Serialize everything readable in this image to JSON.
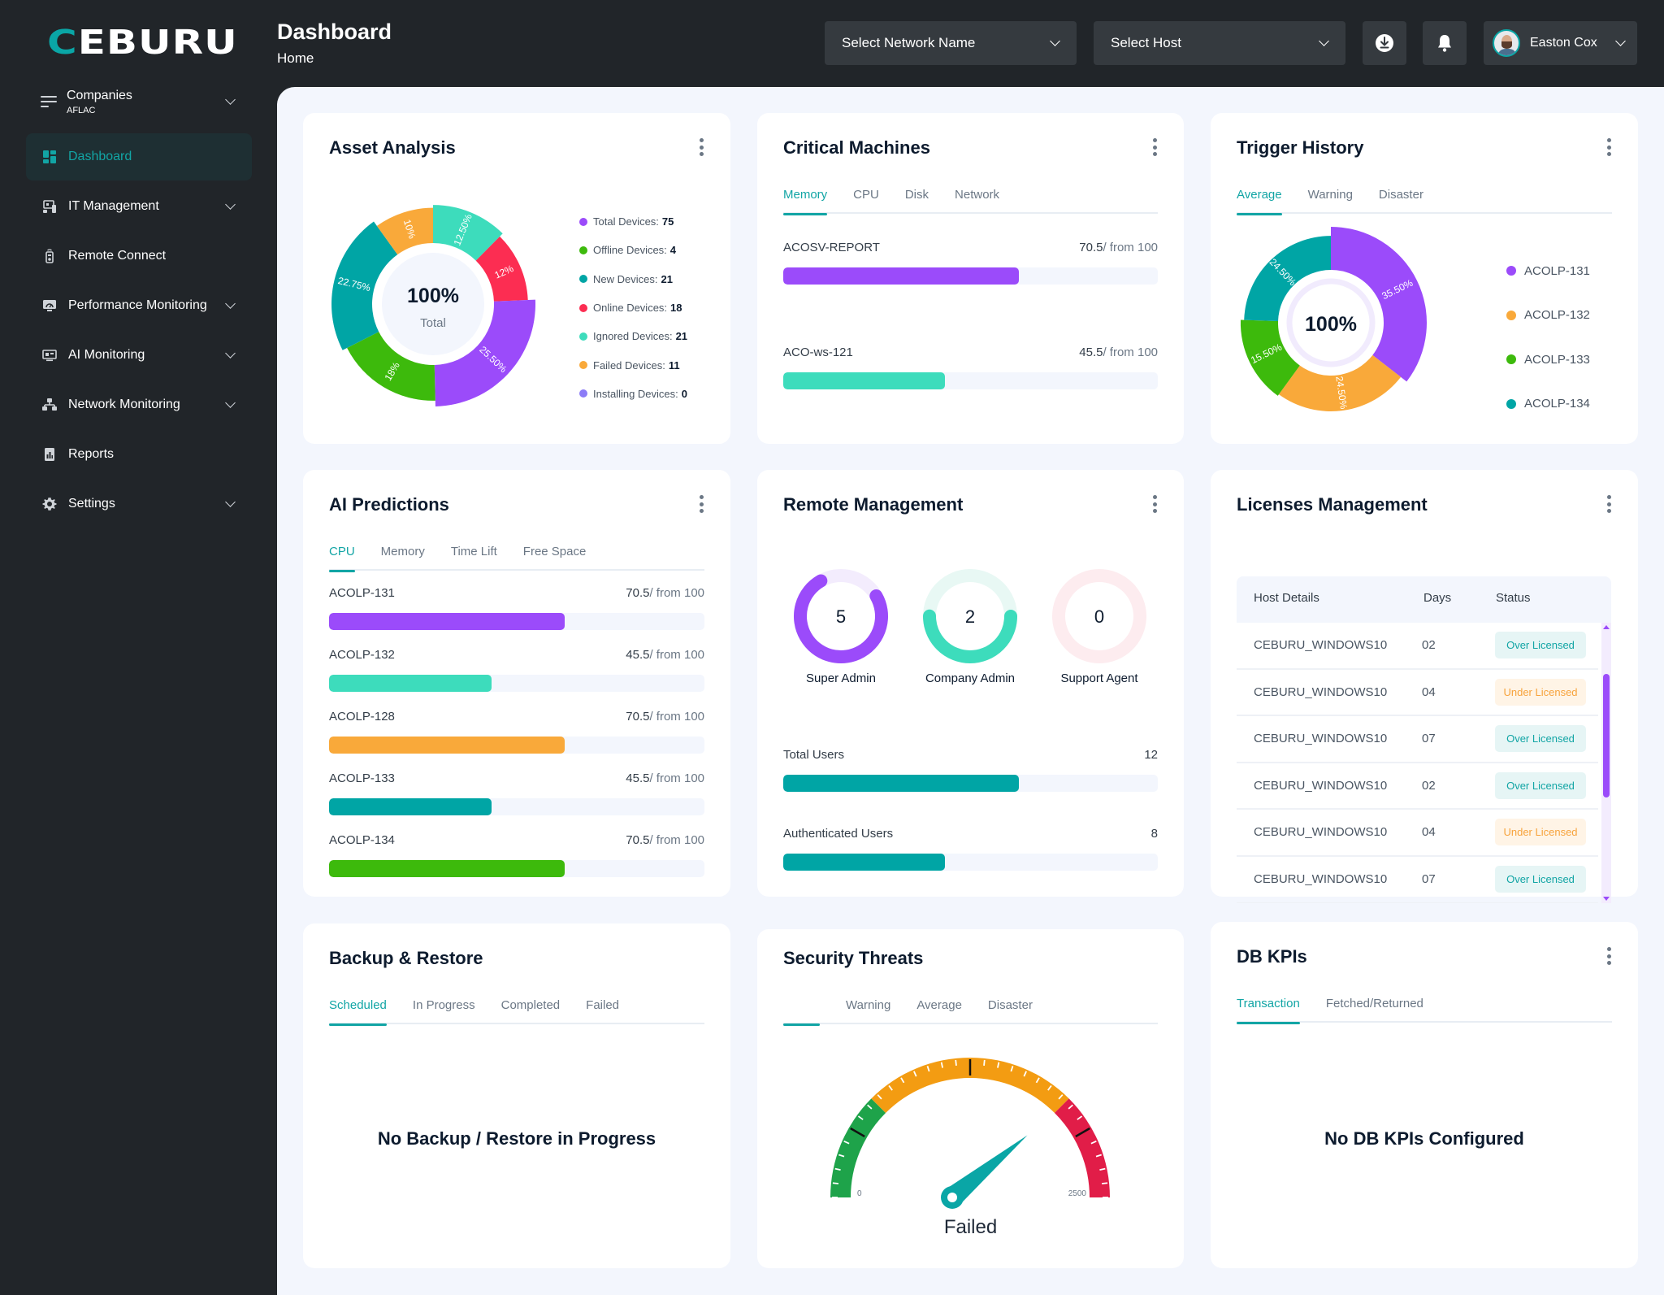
{
  "app": {
    "logo_first": "C",
    "logo_rest": "EBURU",
    "brand_color": "#12a5a5"
  },
  "sidebar": {
    "company": {
      "label": "Companies",
      "value": "AFLAC",
      "icon": "menu-lines-icon"
    },
    "items": [
      {
        "label": "Dashboard",
        "icon": "dashboard-icon",
        "active": true,
        "expandable": false
      },
      {
        "label": "IT Management",
        "icon": "it-management-icon",
        "expandable": true
      },
      {
        "label": "Remote Connect",
        "icon": "remote-icon",
        "expandable": false
      },
      {
        "label": "Performance Monitoring",
        "icon": "gauge-monitor-icon",
        "expandable": true
      },
      {
        "label": "AI Monitoring",
        "icon": "ai-monitor-icon",
        "expandable": true
      },
      {
        "label": "Network Monitoring",
        "icon": "network-icon",
        "expandable": true
      },
      {
        "label": "Reports",
        "icon": "report-icon",
        "expandable": false
      },
      {
        "label": "Settings",
        "icon": "gear-icon",
        "expandable": true
      }
    ]
  },
  "header": {
    "title": "Dashboard",
    "breadcrumb": "Home",
    "network_select": "Select Network Name",
    "host_select": "Select Host",
    "download_icon": "download-icon",
    "bell_icon": "bell-icon",
    "user_name": "Easton Cox"
  },
  "asset_analysis": {
    "title": "Asset Analysis",
    "center_value": "100%",
    "center_label": "Total",
    "legend": [
      {
        "label": "Total Devices:",
        "value": "75",
        "color": "#9b4bfa"
      },
      {
        "label": "Offline Devices:",
        "value": "4",
        "color": "#3dba0c"
      },
      {
        "label": "New Devices:",
        "value": "21",
        "color": "#00a5a5"
      },
      {
        "label": "Online Devices:",
        "value": "18",
        "color": "#fc2d52"
      },
      {
        "label": "Ignored Devices:",
        "value": "21",
        "color": "#3ddcbc"
      },
      {
        "label": "Failed Devices:",
        "value": "11",
        "color": "#f9a93a"
      },
      {
        "label": "Installing Devices:",
        "value": "0",
        "color": "#8c7cf7"
      }
    ]
  },
  "chart_data": [
    {
      "type": "pie",
      "title": "Asset Analysis",
      "variant": "variable-radius donut",
      "center_text": "100% Total",
      "slices": [
        {
          "label": "12.50%",
          "value": 12.5,
          "color": "#3ddcbc",
          "radius_level": 0.92
        },
        {
          "label": "12%",
          "value": 12,
          "color": "#fc2d52",
          "radius_level": 0.82
        },
        {
          "label": "25.50%",
          "value": 25.5,
          "color": "#9b4bfa",
          "radius_level": 1.0
        },
        {
          "label": "18%",
          "value": 18,
          "color": "#3dba0c",
          "radius_level": 0.86
        },
        {
          "label": "22.75%",
          "value": 22.75,
          "color": "#00a5a5",
          "radius_level": 0.98
        },
        {
          "label": "10%",
          "value": 10,
          "color": "#f9a93a",
          "radius_level": 0.85
        }
      ]
    },
    {
      "type": "pie",
      "title": "Trigger History",
      "variant": "variable-radius donut",
      "center_text": "100%",
      "legend": [
        "ACOLP-131",
        "ACOLP-132",
        "ACOLP-133",
        "ACOLP-134"
      ],
      "slices": [
        {
          "label": "35.50%",
          "value": 35.5,
          "color": "#9b4bfa",
          "radius_level": 1.0
        },
        {
          "label": "24.50%",
          "value": 24.5,
          "color": "#f9a93a",
          "radius_level": 0.83
        },
        {
          "label": "15.50%",
          "value": 15.5,
          "color": "#3dba0c",
          "radius_level": 0.87
        },
        {
          "label": "24.50%",
          "value": 24.5,
          "color": "#00a5a5",
          "radius_level": 0.79
        }
      ]
    },
    {
      "type": "gauge",
      "title": "Security Threats",
      "min": 0,
      "max": 2500,
      "min_label": "0",
      "max_label": "2500",
      "value_fraction": 0.78,
      "status_label": "Failed",
      "bands": [
        {
          "from": 0,
          "to": 0.25,
          "color": "#1ea34a"
        },
        {
          "from": 0.25,
          "to": 0.75,
          "color": "#f39c12"
        },
        {
          "from": 0.75,
          "to": 1.0,
          "color": "#e11d48"
        }
      ]
    }
  ],
  "critical_machines": {
    "title": "Critical Machines",
    "tabs": [
      "Memory",
      "CPU",
      "Disk",
      "Network"
    ],
    "active_tab": 0,
    "rows": [
      {
        "name": "ACOSV-REPORT",
        "value": "70.5",
        "suffix": "/ from 100",
        "percent": 62.8,
        "color": "#9b4bfa"
      },
      {
        "name": "ACO-ws-121",
        "value": "45.5",
        "suffix": "/ from 100",
        "percent": 43.2,
        "color": "#3ddcbc"
      }
    ]
  },
  "trigger_history": {
    "title": "Trigger History",
    "tabs": [
      "Average",
      "Warning",
      "Disaster"
    ],
    "active_tab": 0,
    "center": "100%",
    "legend": [
      {
        "label": "ACOLP-131",
        "color": "#9b4bfa"
      },
      {
        "label": "ACOLP-132",
        "color": "#f9a93a"
      },
      {
        "label": "ACOLP-133",
        "color": "#3dba0c"
      },
      {
        "label": "ACOLP-134",
        "color": "#00a5a5"
      }
    ]
  },
  "ai_predictions": {
    "title": "AI Predictions",
    "tabs": [
      "CPU",
      "Memory",
      "Time Lift",
      "Free Space"
    ],
    "active_tab": 0,
    "rows": [
      {
        "name": "ACOLP-131",
        "value": "70.5",
        "suffix": "/ from 100",
        "percent": 62.8,
        "color": "#9b4bfa"
      },
      {
        "name": "ACOLP-132",
        "value": "45.5",
        "suffix": "/ from 100",
        "percent": 43.2,
        "color": "#3ddcbc"
      },
      {
        "name": "ACOLP-128",
        "value": "70.5",
        "suffix": "/ from 100",
        "percent": 62.8,
        "color": "#f9a93a"
      },
      {
        "name": "ACOLP-133",
        "value": "45.5",
        "suffix": "/ from 100",
        "percent": 43.2,
        "color": "#00a5a5"
      },
      {
        "name": "ACOLP-134",
        "value": "70.5",
        "suffix": "/ from 100",
        "percent": 62.8,
        "color": "#3dba0c"
      }
    ]
  },
  "remote_management": {
    "title": "Remote Management",
    "rings": [
      {
        "label": "Super Admin",
        "value": "5",
        "fraction": 0.75,
        "color": "#9b4bfa",
        "track": "#f3ecfd"
      },
      {
        "label": "Company Admin",
        "value": "2",
        "fraction": 0.5,
        "color": "#3ddcbc",
        "track": "#e8f8f4"
      },
      {
        "label": "Support Agent",
        "value": "0",
        "fraction": 0,
        "color": "#fc2d52",
        "track": "#fdecef"
      }
    ],
    "bars": [
      {
        "label": "Total Users",
        "value": "12",
        "percent": 62.8,
        "color": "#00a5a5"
      },
      {
        "label": "Authenticated Users",
        "value": "8",
        "percent": 43.2,
        "color": "#00a5a5"
      }
    ]
  },
  "licenses": {
    "title": "Licenses Management",
    "columns": [
      "Host Details",
      "Days",
      "Status"
    ],
    "rows": [
      {
        "host": "CEBURU_WINDOWS10",
        "days": "02",
        "status": "Over Licensed",
        "kind": "over"
      },
      {
        "host": "CEBURU_WINDOWS10",
        "days": "04",
        "status": "Under Licensed",
        "kind": "under"
      },
      {
        "host": "CEBURU_WINDOWS10",
        "days": "07",
        "status": "Over Licensed",
        "kind": "over"
      },
      {
        "host": "CEBURU_WINDOWS10",
        "days": "02",
        "status": "Over Licensed",
        "kind": "over"
      },
      {
        "host": "CEBURU_WINDOWS10",
        "days": "04",
        "status": "Under Licensed",
        "kind": "under"
      },
      {
        "host": "CEBURU_WINDOWS10",
        "days": "07",
        "status": "Over Licensed",
        "kind": "over"
      }
    ]
  },
  "backup_restore": {
    "title": "Backup & Restore",
    "tabs": [
      "Scheduled",
      "In Progress",
      "Completed",
      "Failed"
    ],
    "active_tab": 0,
    "empty_message": "No Backup / Restore in Progress"
  },
  "security_threats": {
    "title": "Security Threats",
    "tabs": [
      "",
      "Warning",
      "Average",
      "Disaster"
    ],
    "active_tab": 0,
    "min_label": "0",
    "max_label": "2500",
    "status": "Failed"
  },
  "db_kpis": {
    "title": "DB KPIs",
    "tabs": [
      "Transaction",
      "Fetched/Returned"
    ],
    "active_tab": 0,
    "empty_message": "No DB KPIs Configured"
  }
}
